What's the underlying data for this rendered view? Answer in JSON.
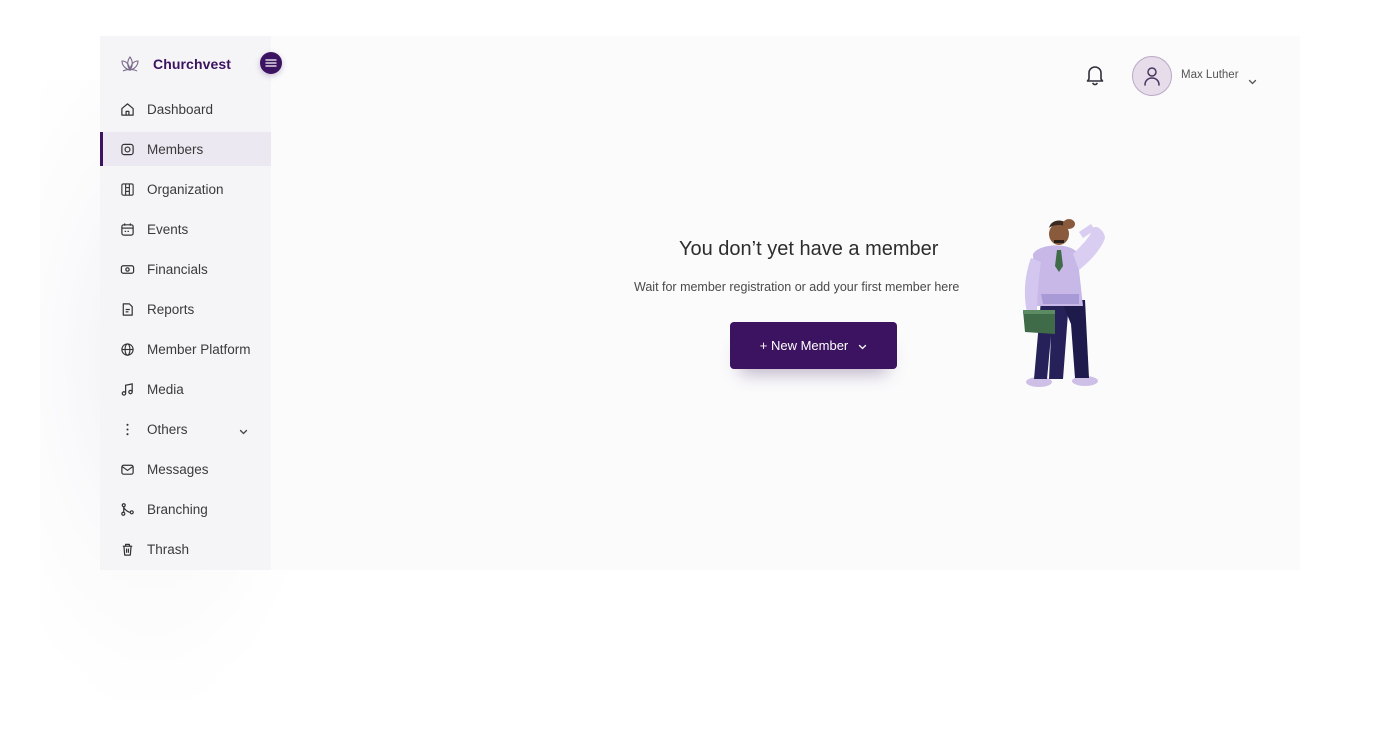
{
  "brand": {
    "name": "Churchvest",
    "logo_icon": "lotus-logo-icon",
    "accent": "#3b1360"
  },
  "sidebar": {
    "toggle_icon": "menu-toggle-icon",
    "items": [
      {
        "label": "Dashboard",
        "icon": "home-icon",
        "active": false
      },
      {
        "label": "Members",
        "icon": "camera-icon",
        "active": true
      },
      {
        "label": "Organization",
        "icon": "building-icon",
        "active": false
      },
      {
        "label": "Events",
        "icon": "calendar-icon",
        "active": false
      },
      {
        "label": "Financials",
        "icon": "money-icon",
        "active": false
      },
      {
        "label": "Reports",
        "icon": "document-icon",
        "active": false
      },
      {
        "label": "Member Platform",
        "icon": "globe-icon",
        "active": false
      },
      {
        "label": "Media",
        "icon": "music-icon",
        "active": false
      },
      {
        "label": "Others",
        "icon": "more-vertical-icon",
        "active": false,
        "has_dropdown": true
      },
      {
        "label": "Messages",
        "icon": "mail-icon",
        "active": false
      },
      {
        "label": "Branching",
        "icon": "branch-icon",
        "active": false
      },
      {
        "label": "Thrash",
        "icon": "trash-icon",
        "active": false
      }
    ]
  },
  "header": {
    "notification_icon": "bell-icon",
    "user": {
      "name": "Max Luther",
      "avatar_icon": "user-icon"
    }
  },
  "empty_state": {
    "title": "You don’t yet have a member",
    "subtitle": "Wait for member registration or add your first member here",
    "button_label": "+ New Member",
    "illustration": "confused-man-illustration"
  }
}
